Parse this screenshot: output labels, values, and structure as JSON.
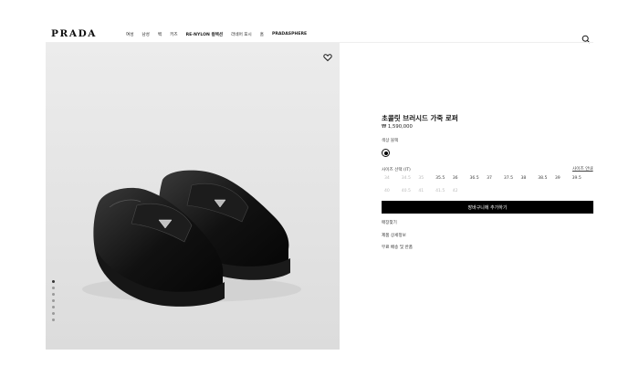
{
  "header": {
    "logo": "PRADA",
    "nav": [
      {
        "label": "여성",
        "bold": false
      },
      {
        "label": "남성",
        "bold": false
      },
      {
        "label": "백",
        "bold": false
      },
      {
        "label": "키즈",
        "bold": false
      },
      {
        "label": "RE-NYLON 컬렉션",
        "bold": true
      },
      {
        "label": "라네어 포시",
        "bold": false
      },
      {
        "label": "홈",
        "bold": false
      },
      {
        "label": "PRADASPHERE",
        "bold": true
      }
    ],
    "search_icon": "search-icon"
  },
  "gallery": {
    "wishlist_icon": "heart-icon",
    "dot_count": 7,
    "active_dot": 0
  },
  "product": {
    "title": "초콜릿 브러시드 가죽 로퍼",
    "price": "₩ 1,590,000",
    "color_label": "색상  블랙",
    "size_label": "사이즈 선택 (IT)",
    "size_guide": "사이즈 안내",
    "sizes": [
      {
        "label": "34",
        "available": false
      },
      {
        "label": "34.5",
        "available": false
      },
      {
        "label": "35",
        "available": false
      },
      {
        "label": "35.5",
        "available": true
      },
      {
        "label": "36",
        "available": true
      },
      {
        "label": "36.5",
        "available": true
      },
      {
        "label": "37",
        "available": true
      },
      {
        "label": "37.5",
        "available": true
      },
      {
        "label": "38",
        "available": true
      },
      {
        "label": "38.5",
        "available": true
      },
      {
        "label": "39",
        "available": true
      },
      {
        "label": "39.5",
        "available": true
      },
      {
        "label": "40",
        "available": false
      },
      {
        "label": "40.5",
        "available": false
      },
      {
        "label": "41",
        "available": false
      },
      {
        "label": "41.5",
        "available": false
      },
      {
        "label": "42",
        "available": false
      }
    ],
    "add_to_cart": "장바구니에 추가하기",
    "links": [
      "매장찾기",
      "제품 상세정보",
      "무료 배송 및 반품"
    ]
  }
}
